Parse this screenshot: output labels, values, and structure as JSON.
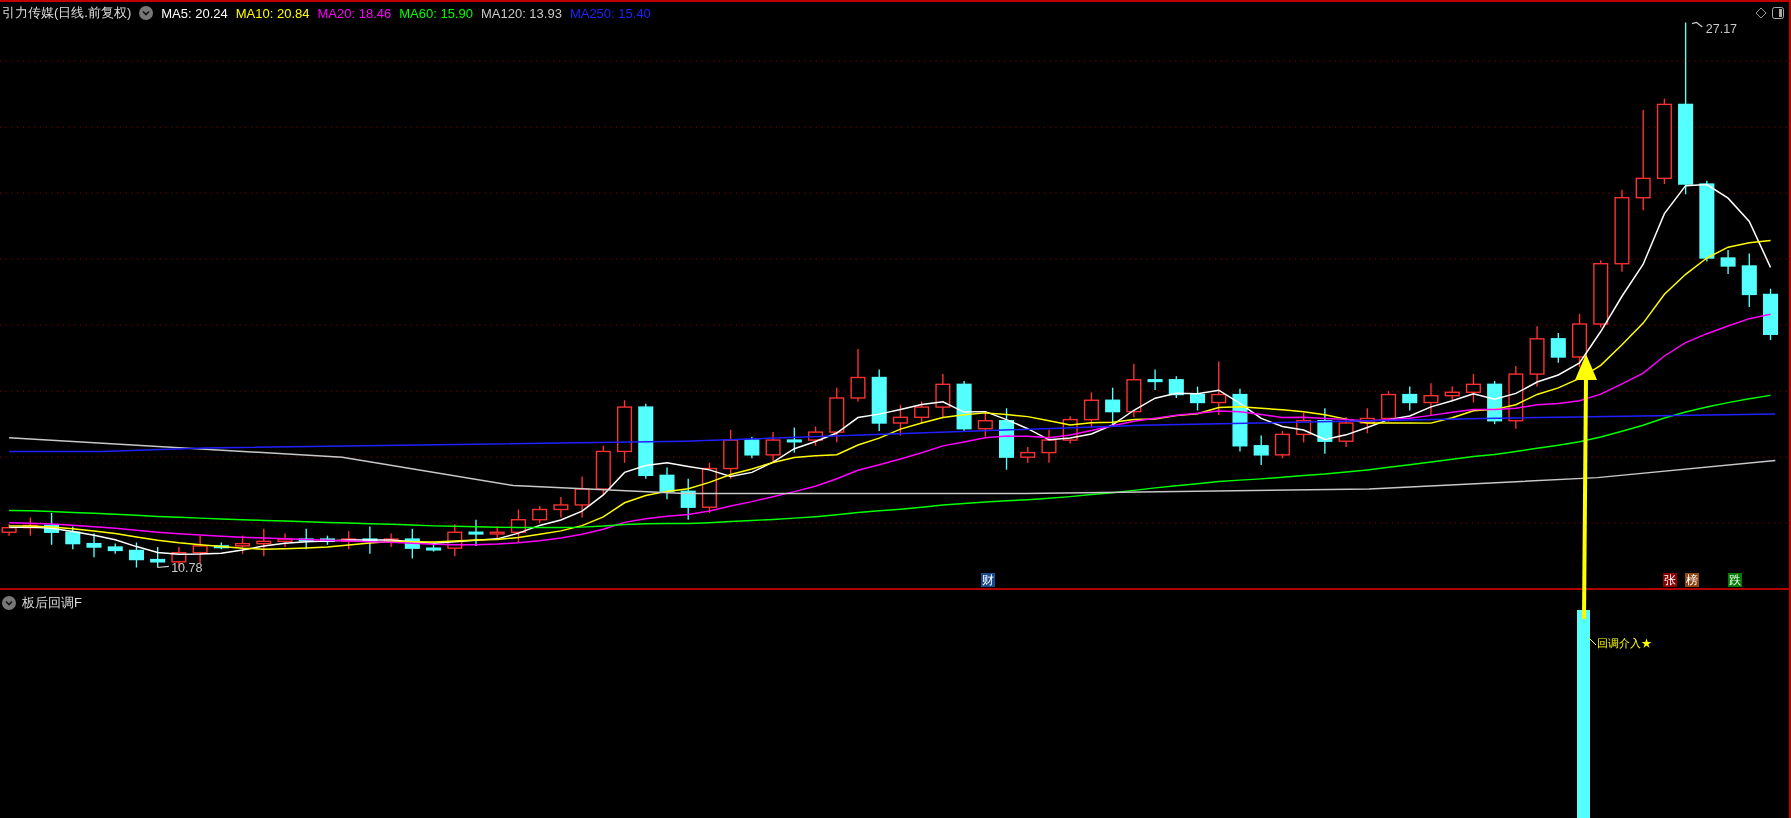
{
  "stock": {
    "title": "引力传媒(日线.前复权)"
  },
  "ma_legend": [
    {
      "label": "MA5: 20.24",
      "color": "#ffffff"
    },
    {
      "label": "MA10: 20.84",
      "color": "#ffff00"
    },
    {
      "label": "MA20: 18.46",
      "color": "#ff00ff"
    },
    {
      "label": "MA60: 15.90",
      "color": "#00ff00"
    },
    {
      "label": "MA120: 13.93",
      "color": "#c8c8c8"
    },
    {
      "label": "MA250: 15.40",
      "color": "#2020ff"
    }
  ],
  "price_chart": {
    "high_label": "27.17",
    "low_label": "10.78",
    "event_markers": [
      {
        "label": "财",
        "color": "#1a4a8a"
      },
      {
        "label": "张",
        "color": "#8b0000"
      },
      {
        "label": "榜",
        "color": "#8b4513"
      },
      {
        "label": "跌",
        "color": "#007a00"
      }
    ]
  },
  "indicator_panel": {
    "title": "板后回调F",
    "signal_label": "回调介入★"
  }
}
